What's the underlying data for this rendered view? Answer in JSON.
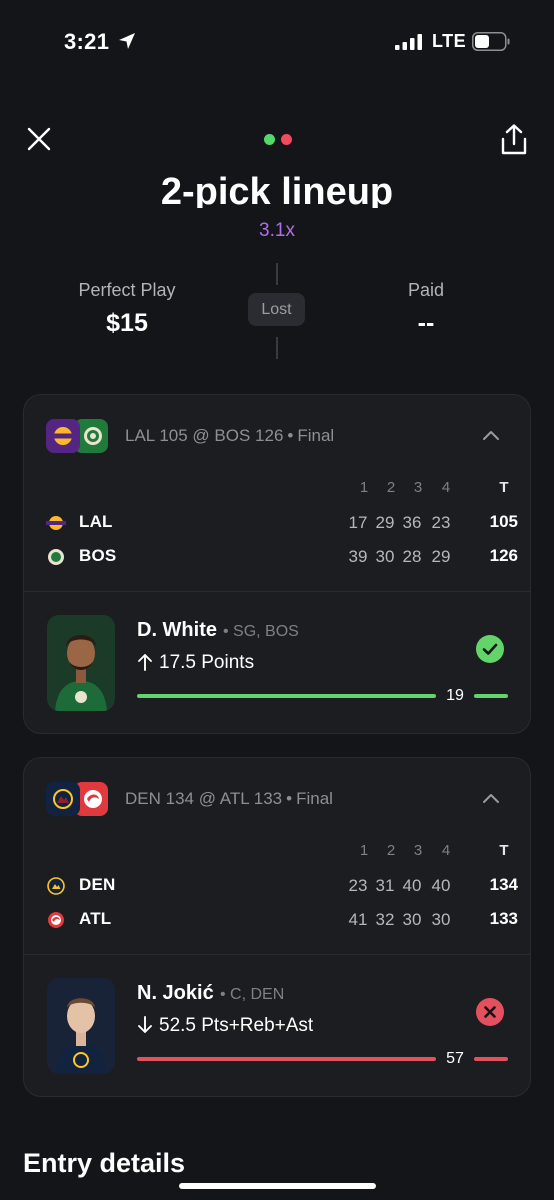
{
  "status_bar": {
    "time": "3:21",
    "network": "LTE"
  },
  "header": {
    "title": "2-pick lineup",
    "multiplier": "3.1x",
    "dot_colors": [
      "#53d96a",
      "#ef4c5c"
    ]
  },
  "summary": {
    "left_label": "Perfect Play",
    "left_value": "$15",
    "status": "Lost",
    "right_label": "Paid",
    "right_value": "--"
  },
  "games": [
    {
      "matchup": "LAL 105 @ BOS 126",
      "state": "Final",
      "quarter_headers": [
        "1",
        "2",
        "3",
        "4"
      ],
      "total_header": "T",
      "teams": [
        {
          "abbr": "LAL",
          "quarters": [
            "17",
            "29",
            "36",
            "23"
          ],
          "total": "105",
          "logo": "lakers-logo"
        },
        {
          "abbr": "BOS",
          "quarters": [
            "39",
            "30",
            "28",
            "29"
          ],
          "total": "126",
          "logo": "celtics-logo"
        }
      ],
      "pick": {
        "player": "D. White",
        "meta": "SG, BOS",
        "direction": "up",
        "line": "17.5 Points",
        "result_value": "19",
        "result": "won",
        "progress": 1.0,
        "accent": "#63d46a"
      }
    },
    {
      "matchup": "DEN 134 @ ATL 133",
      "state": "Final",
      "quarter_headers": [
        "1",
        "2",
        "3",
        "4"
      ],
      "total_header": "T",
      "teams": [
        {
          "abbr": "DEN",
          "quarters": [
            "23",
            "31",
            "40",
            "40"
          ],
          "total": "134",
          "logo": "nuggets-logo"
        },
        {
          "abbr": "ATL",
          "quarters": [
            "41",
            "32",
            "30",
            "30"
          ],
          "total": "133",
          "logo": "hawks-logo"
        }
      ],
      "pick": {
        "player": "N. Jokić",
        "meta": "C, DEN",
        "direction": "down",
        "line": "52.5 Pts+Reb+Ast",
        "result_value": "57",
        "result": "lost",
        "progress": 1.0,
        "accent": "#e5505e"
      }
    }
  ],
  "footer": {
    "section_title": "Entry details"
  }
}
